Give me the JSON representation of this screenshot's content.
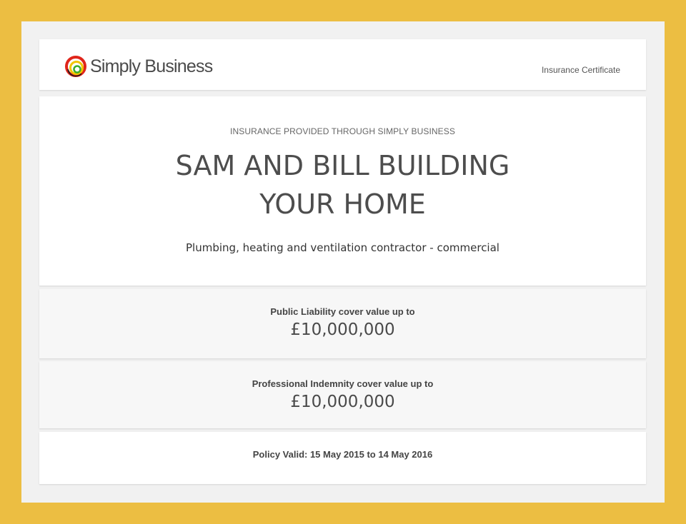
{
  "header": {
    "logo_text": "Simply Business",
    "logo_icon": "simply-business-rings-logo",
    "document_type": "Insurance Certificate"
  },
  "main": {
    "eyebrow": "INSURANCE PROVIDED THROUGH SIMPLY BUSINESS",
    "company_line1": "SAM AND BILL BUILDING",
    "company_line2": "YOUR HOME",
    "trade": "Plumbing, heating and ventilation contractor - commercial"
  },
  "covers": [
    {
      "label": "Public Liability cover value up to",
      "value": "£10,000,000"
    },
    {
      "label": "Professional Indemnity cover value up to",
      "value": "£10,000,000"
    }
  ],
  "validity": "Policy Valid: 15 May 2015 to 14 May 2016",
  "colors": {
    "outer_background": "#ECBE42",
    "frame_background": "#F1F1F1",
    "card_background": "#FFFFFF",
    "cover_card_background": "#F7F7F7",
    "logo_red": "#E0251B",
    "logo_yellow": "#F2C500",
    "logo_green": "#3DAE2B"
  }
}
